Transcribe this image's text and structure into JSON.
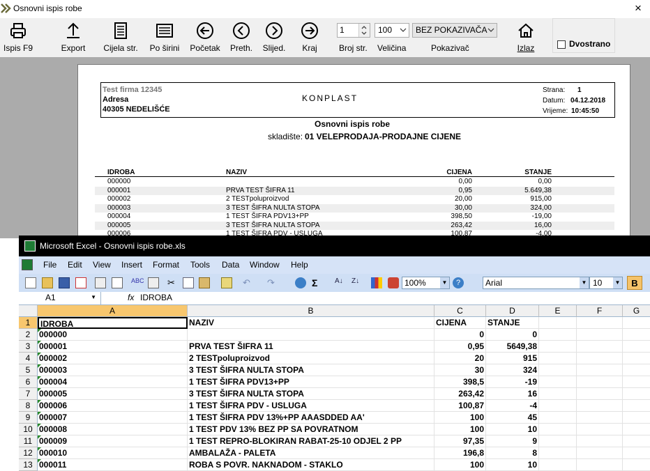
{
  "print_window": {
    "title": "Osnovni ispis robe",
    "close_glyph": "×",
    "toolbar": {
      "print_label": "Ispis  F9",
      "export_label": "Export",
      "whole_page_label": "Cijela str.",
      "page_width_label": "Po širini",
      "first_label": "Početak",
      "prev_label": "Preth.",
      "next_label": "Slijed.",
      "last_label": "Kraj",
      "page_count_value": "1",
      "page_count_label": "Broj str.",
      "zoom_value": "100",
      "zoom_label": "Veličina",
      "pointer_value": "BEZ POKAZIVAČA",
      "pointer_label": "Pokazivač",
      "exit_label": "Izlaz",
      "duplex_label": "Dvostrano",
      "duplex_checked": false
    },
    "report": {
      "company_name": "Test firma 12345",
      "address": "Adresa",
      "city": "40305 NEDELIŠĆE",
      "brand": "KONPLAST",
      "page_label": "Strana:",
      "page_value": "1",
      "date_label": "Datum:",
      "date_value": "04.12.2018",
      "time_label": "Vrijeme:",
      "time_value": "10:45:50",
      "report_title": "Osnovni ispis robe",
      "warehouse_label": "skladište:",
      "warehouse_value": "01 VELEPRODAJA-PRODAJNE CIJENE",
      "columns": [
        "IDROBA",
        "NAZIV",
        "CIJENA",
        "STANJE"
      ],
      "rows": [
        [
          "000000",
          "",
          "0,00",
          "0,00"
        ],
        [
          "000001",
          "PRVA TEST ŠIFRA 11",
          "0,95",
          "5.649,38"
        ],
        [
          "000002",
          "2 TESTpoluproizvod",
          "20,00",
          "915,00"
        ],
        [
          "000003",
          "3 TEST ŠIFRA NULTA STOPA",
          "30,00",
          "324,00"
        ],
        [
          "000004",
          "1 TEST ŠIFRA  PDV13+PP",
          "398,50",
          "-19,00"
        ],
        [
          "000005",
          "3 TEST ŠIFRA NULTA STOPA",
          "263,42",
          "16,00"
        ],
        [
          "000006",
          "1 TEST ŠIFRA  PDV - USLUGA",
          "100,87",
          "-4,00"
        ]
      ]
    }
  },
  "excel": {
    "title": "Microsoft Excel - Osnovni ispis robe.xls",
    "menu": [
      "File",
      "Edit",
      "View",
      "Insert",
      "Format",
      "Tools",
      "Data",
      "Window",
      "Help"
    ],
    "zoom": "100%",
    "font_name": "Arial",
    "font_size": "10",
    "bold_label": "B",
    "name_box": "A1",
    "fx_label": "fx",
    "formula": "IDROBA",
    "columns": [
      "A",
      "B",
      "C",
      "D",
      "E",
      "F",
      "G"
    ],
    "rows": [
      {
        "n": "1",
        "a": "IDROBA",
        "b": "NAZIV",
        "c": "CIJENA",
        "d": "STANJE"
      },
      {
        "n": "2",
        "a": "000000",
        "b": "",
        "c": "0",
        "d": "0"
      },
      {
        "n": "3",
        "a": "000001",
        "b": "PRVA TEST ŠIFRA 11",
        "c": "0,95",
        "d": "5649,38"
      },
      {
        "n": "4",
        "a": "000002",
        "b": "2 TESTpoluproizvod",
        "c": "20",
        "d": "915"
      },
      {
        "n": "5",
        "a": "000003",
        "b": "3 TEST ŠIFRA NULTA STOPA",
        "c": "30",
        "d": "324"
      },
      {
        "n": "6",
        "a": "000004",
        "b": "1 TEST ŠIFRA  PDV13+PP",
        "c": "398,5",
        "d": "-19"
      },
      {
        "n": "7",
        "a": "000005",
        "b": "3 TEST ŠIFRA NULTA STOPA",
        "c": "263,42",
        "d": "16"
      },
      {
        "n": "8",
        "a": "000006",
        "b": "1 TEST ŠIFRA  PDV - USLUGA",
        "c": "100,87",
        "d": "-4"
      },
      {
        "n": "9",
        "a": "000007",
        "b": "1 TEST ŠIFRA  PDV 13%+PP AAASDDED AA'",
        "c": "100",
        "d": "45"
      },
      {
        "n": "10",
        "a": "000008",
        "b": "1 TEST  PDV 13% BEZ PP SA POVRATNOM",
        "c": "100",
        "d": "10"
      },
      {
        "n": "11",
        "a": "000009",
        "b": "1 TEST REPRO-BLOKIRAN RABAT-25-10 ODJEL 2 PP",
        "c": "97,35",
        "d": "9"
      },
      {
        "n": "12",
        "a": "000010",
        "b": "AMBALAŽA - PALETA",
        "c": "196,8",
        "d": "8"
      },
      {
        "n": "13",
        "a": "000011",
        "b": "ROBA S POVR. NAKNADOM - STAKLO",
        "c": "100",
        "d": "10"
      }
    ]
  }
}
